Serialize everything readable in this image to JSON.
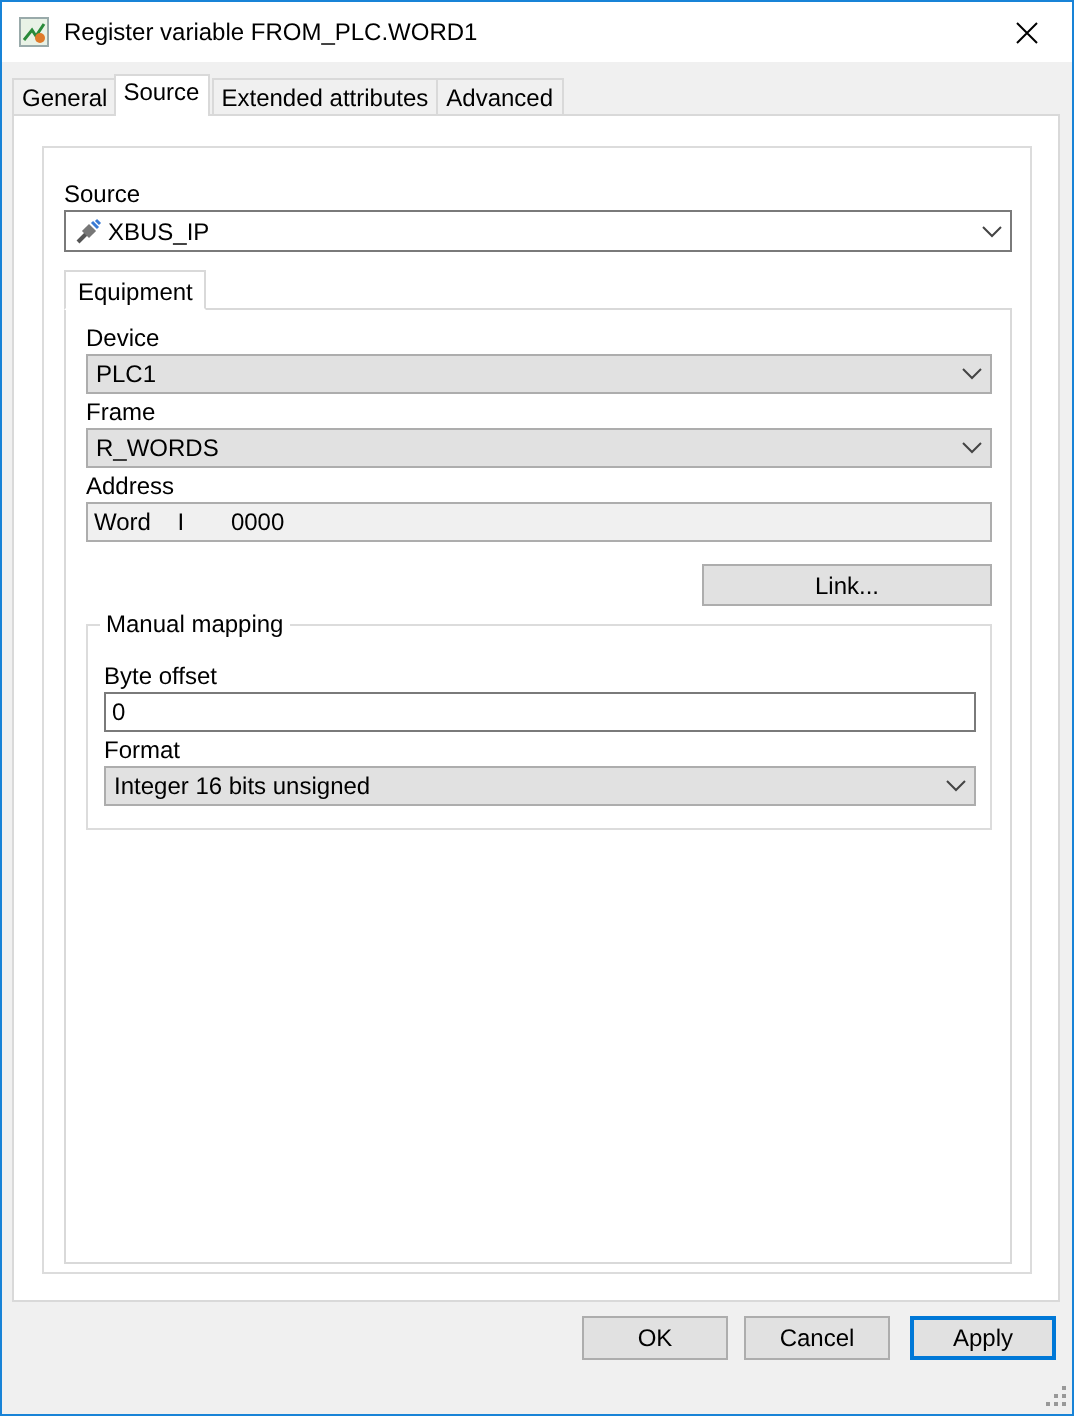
{
  "window": {
    "title": "Register variable FROM_PLC.WORD1"
  },
  "tabs": [
    {
      "label": "General",
      "selected": false
    },
    {
      "label": "Source",
      "selected": true
    },
    {
      "label": "Extended attributes",
      "selected": false
    },
    {
      "label": "Advanced",
      "selected": false
    }
  ],
  "source": {
    "label": "Source",
    "value": "XBUS_IP"
  },
  "inner_tabs": [
    {
      "label": "Equipment",
      "selected": true
    }
  ],
  "equipment_fields": [
    {
      "kind": "combo",
      "label": "Device",
      "value": "PLC1"
    },
    {
      "kind": "combo",
      "label": "Frame",
      "value": "R_WORDS"
    },
    {
      "kind": "readonly",
      "label": "Address",
      "value": "Word    I       0000"
    }
  ],
  "link_button": "Link...",
  "manual_mapping": {
    "title": "Manual mapping",
    "fields": [
      {
        "kind": "text",
        "label": "Byte offset",
        "value": "0"
      },
      {
        "kind": "combo",
        "label": "Format",
        "value": "Integer 16 bits unsigned"
      }
    ]
  },
  "buttons": [
    {
      "label": "OK",
      "default": false
    },
    {
      "label": "Cancel",
      "default": false
    },
    {
      "label": "Apply",
      "default": true
    }
  ]
}
